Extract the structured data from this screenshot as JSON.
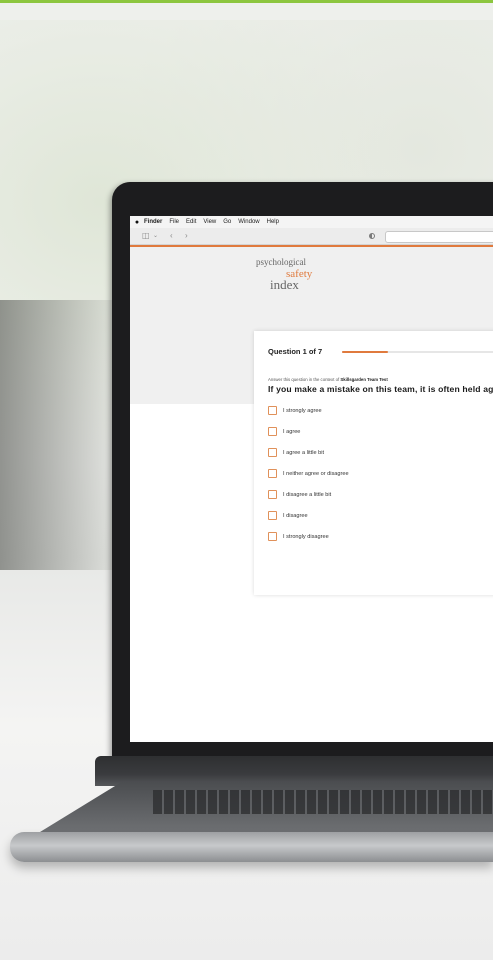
{
  "colors": {
    "accent": "#e07a3d",
    "top_strip": "#8cc63f"
  },
  "menubar": {
    "apple_icon": "apple-icon",
    "items": [
      "Finder",
      "File",
      "Edit",
      "View",
      "Go",
      "Window",
      "Help"
    ]
  },
  "toolbar": {
    "icons": [
      "sidebar-icon",
      "chevron-down-icon",
      "back-icon",
      "forward-icon",
      "privacy-shield-icon"
    ]
  },
  "logo": {
    "line1": "psychological",
    "line2": "safety",
    "line3": "index"
  },
  "question_card": {
    "counter": "Question 1 of 7",
    "progress_fraction": 0.2857,
    "context_prefix": "Answer this question in the context of",
    "context_team": "Skillsgarden Team Test",
    "question_text": "If you make a mistake on this team, it is often held ag",
    "options": [
      "I strongly agree",
      "I agree",
      "I agree a little bit",
      "I neither agree or disagree",
      "I disagree a little bit",
      "I disagree",
      "I strongly disagree"
    ]
  }
}
